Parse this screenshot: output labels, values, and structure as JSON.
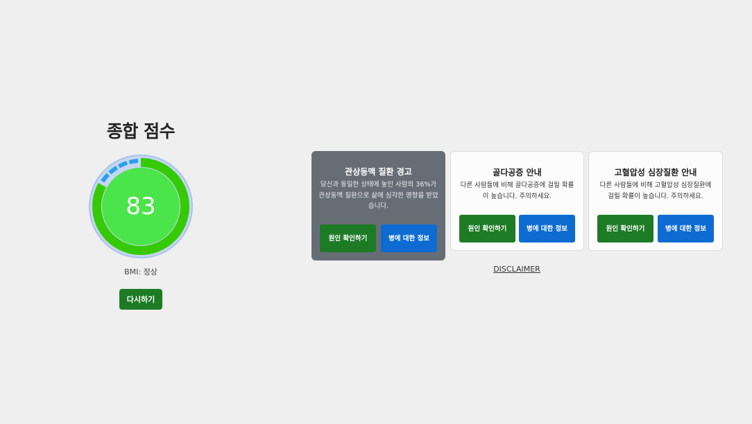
{
  "score": {
    "title": "종합 점수",
    "value": "83",
    "value_fraction": 0.83,
    "bmi_label": "BMI: 정상",
    "retry_label": "다시하기",
    "colors": {
      "progress": "#35c906",
      "inner": "#4be44b",
      "track": "#c5d6f0",
      "track_border": "#a9c4ea",
      "tick_marks": "#2a9ef0"
    }
  },
  "cards": [
    {
      "title": "관상동맥 질환 경고",
      "text": "당신과 동일한 상태에 놓인 사람의 36%가 관상동맥 질환으로 삶에 심각한 영향을 받았습니다.",
      "cause_button": "원인 확인하기",
      "info_button": "병에 대한 정보",
      "style": "warning"
    },
    {
      "title": "골다공증 안내",
      "text": "다른 사람들에 비해 골다공증에 걸릴 확률이 높습니다. 주의하세요.",
      "cause_button": "원인 확인하기",
      "info_button": "병에 대한 정보",
      "style": "info"
    },
    {
      "title": "고혈압성 심장질환 안내",
      "text": "다른 사람들에 비해 고혈압성 심장질환에 걸릴 확률이 높습니다. 주의하세요.",
      "cause_button": "원인 확인하기",
      "info_button": "병에 대한 정보",
      "style": "info"
    }
  ],
  "disclaimer_label": "DISCLAIMER"
}
